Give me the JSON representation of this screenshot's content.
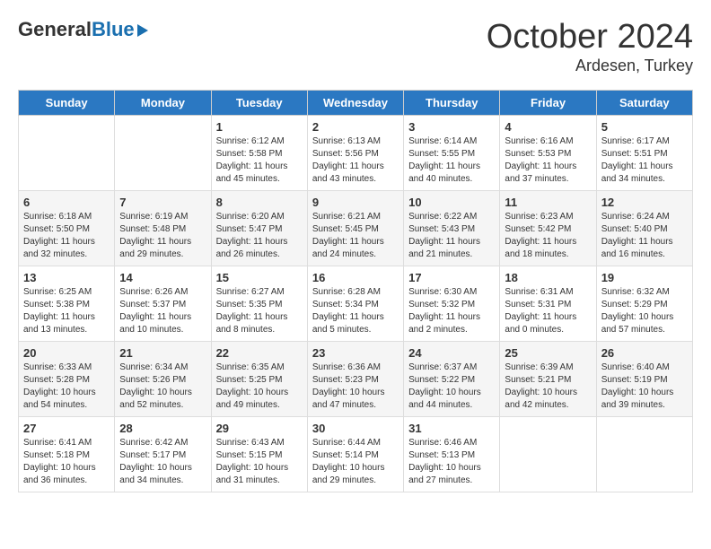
{
  "logo": {
    "general": "General",
    "blue": "Blue"
  },
  "header": {
    "month": "October 2024",
    "location": "Ardesen, Turkey"
  },
  "weekdays": [
    "Sunday",
    "Monday",
    "Tuesday",
    "Wednesday",
    "Thursday",
    "Friday",
    "Saturday"
  ],
  "weeks": [
    [
      {
        "day": "",
        "info": ""
      },
      {
        "day": "",
        "info": ""
      },
      {
        "day": "1",
        "sunrise": "Sunrise: 6:12 AM",
        "sunset": "Sunset: 5:58 PM",
        "daylight": "Daylight: 11 hours and 45 minutes."
      },
      {
        "day": "2",
        "sunrise": "Sunrise: 6:13 AM",
        "sunset": "Sunset: 5:56 PM",
        "daylight": "Daylight: 11 hours and 43 minutes."
      },
      {
        "day": "3",
        "sunrise": "Sunrise: 6:14 AM",
        "sunset": "Sunset: 5:55 PM",
        "daylight": "Daylight: 11 hours and 40 minutes."
      },
      {
        "day": "4",
        "sunrise": "Sunrise: 6:16 AM",
        "sunset": "Sunset: 5:53 PM",
        "daylight": "Daylight: 11 hours and 37 minutes."
      },
      {
        "day": "5",
        "sunrise": "Sunrise: 6:17 AM",
        "sunset": "Sunset: 5:51 PM",
        "daylight": "Daylight: 11 hours and 34 minutes."
      }
    ],
    [
      {
        "day": "6",
        "sunrise": "Sunrise: 6:18 AM",
        "sunset": "Sunset: 5:50 PM",
        "daylight": "Daylight: 11 hours and 32 minutes."
      },
      {
        "day": "7",
        "sunrise": "Sunrise: 6:19 AM",
        "sunset": "Sunset: 5:48 PM",
        "daylight": "Daylight: 11 hours and 29 minutes."
      },
      {
        "day": "8",
        "sunrise": "Sunrise: 6:20 AM",
        "sunset": "Sunset: 5:47 PM",
        "daylight": "Daylight: 11 hours and 26 minutes."
      },
      {
        "day": "9",
        "sunrise": "Sunrise: 6:21 AM",
        "sunset": "Sunset: 5:45 PM",
        "daylight": "Daylight: 11 hours and 24 minutes."
      },
      {
        "day": "10",
        "sunrise": "Sunrise: 6:22 AM",
        "sunset": "Sunset: 5:43 PM",
        "daylight": "Daylight: 11 hours and 21 minutes."
      },
      {
        "day": "11",
        "sunrise": "Sunrise: 6:23 AM",
        "sunset": "Sunset: 5:42 PM",
        "daylight": "Daylight: 11 hours and 18 minutes."
      },
      {
        "day": "12",
        "sunrise": "Sunrise: 6:24 AM",
        "sunset": "Sunset: 5:40 PM",
        "daylight": "Daylight: 11 hours and 16 minutes."
      }
    ],
    [
      {
        "day": "13",
        "sunrise": "Sunrise: 6:25 AM",
        "sunset": "Sunset: 5:38 PM",
        "daylight": "Daylight: 11 hours and 13 minutes."
      },
      {
        "day": "14",
        "sunrise": "Sunrise: 6:26 AM",
        "sunset": "Sunset: 5:37 PM",
        "daylight": "Daylight: 11 hours and 10 minutes."
      },
      {
        "day": "15",
        "sunrise": "Sunrise: 6:27 AM",
        "sunset": "Sunset: 5:35 PM",
        "daylight": "Daylight: 11 hours and 8 minutes."
      },
      {
        "day": "16",
        "sunrise": "Sunrise: 6:28 AM",
        "sunset": "Sunset: 5:34 PM",
        "daylight": "Daylight: 11 hours and 5 minutes."
      },
      {
        "day": "17",
        "sunrise": "Sunrise: 6:30 AM",
        "sunset": "Sunset: 5:32 PM",
        "daylight": "Daylight: 11 hours and 2 minutes."
      },
      {
        "day": "18",
        "sunrise": "Sunrise: 6:31 AM",
        "sunset": "Sunset: 5:31 PM",
        "daylight": "Daylight: 11 hours and 0 minutes."
      },
      {
        "day": "19",
        "sunrise": "Sunrise: 6:32 AM",
        "sunset": "Sunset: 5:29 PM",
        "daylight": "Daylight: 10 hours and 57 minutes."
      }
    ],
    [
      {
        "day": "20",
        "sunrise": "Sunrise: 6:33 AM",
        "sunset": "Sunset: 5:28 PM",
        "daylight": "Daylight: 10 hours and 54 minutes."
      },
      {
        "day": "21",
        "sunrise": "Sunrise: 6:34 AM",
        "sunset": "Sunset: 5:26 PM",
        "daylight": "Daylight: 10 hours and 52 minutes."
      },
      {
        "day": "22",
        "sunrise": "Sunrise: 6:35 AM",
        "sunset": "Sunset: 5:25 PM",
        "daylight": "Daylight: 10 hours and 49 minutes."
      },
      {
        "day": "23",
        "sunrise": "Sunrise: 6:36 AM",
        "sunset": "Sunset: 5:23 PM",
        "daylight": "Daylight: 10 hours and 47 minutes."
      },
      {
        "day": "24",
        "sunrise": "Sunrise: 6:37 AM",
        "sunset": "Sunset: 5:22 PM",
        "daylight": "Daylight: 10 hours and 44 minutes."
      },
      {
        "day": "25",
        "sunrise": "Sunrise: 6:39 AM",
        "sunset": "Sunset: 5:21 PM",
        "daylight": "Daylight: 10 hours and 42 minutes."
      },
      {
        "day": "26",
        "sunrise": "Sunrise: 6:40 AM",
        "sunset": "Sunset: 5:19 PM",
        "daylight": "Daylight: 10 hours and 39 minutes."
      }
    ],
    [
      {
        "day": "27",
        "sunrise": "Sunrise: 6:41 AM",
        "sunset": "Sunset: 5:18 PM",
        "daylight": "Daylight: 10 hours and 36 minutes."
      },
      {
        "day": "28",
        "sunrise": "Sunrise: 6:42 AM",
        "sunset": "Sunset: 5:17 PM",
        "daylight": "Daylight: 10 hours and 34 minutes."
      },
      {
        "day": "29",
        "sunrise": "Sunrise: 6:43 AM",
        "sunset": "Sunset: 5:15 PM",
        "daylight": "Daylight: 10 hours and 31 minutes."
      },
      {
        "day": "30",
        "sunrise": "Sunrise: 6:44 AM",
        "sunset": "Sunset: 5:14 PM",
        "daylight": "Daylight: 10 hours and 29 minutes."
      },
      {
        "day": "31",
        "sunrise": "Sunrise: 6:46 AM",
        "sunset": "Sunset: 5:13 PM",
        "daylight": "Daylight: 10 hours and 27 minutes."
      },
      {
        "day": "",
        "info": ""
      },
      {
        "day": "",
        "info": ""
      }
    ]
  ]
}
